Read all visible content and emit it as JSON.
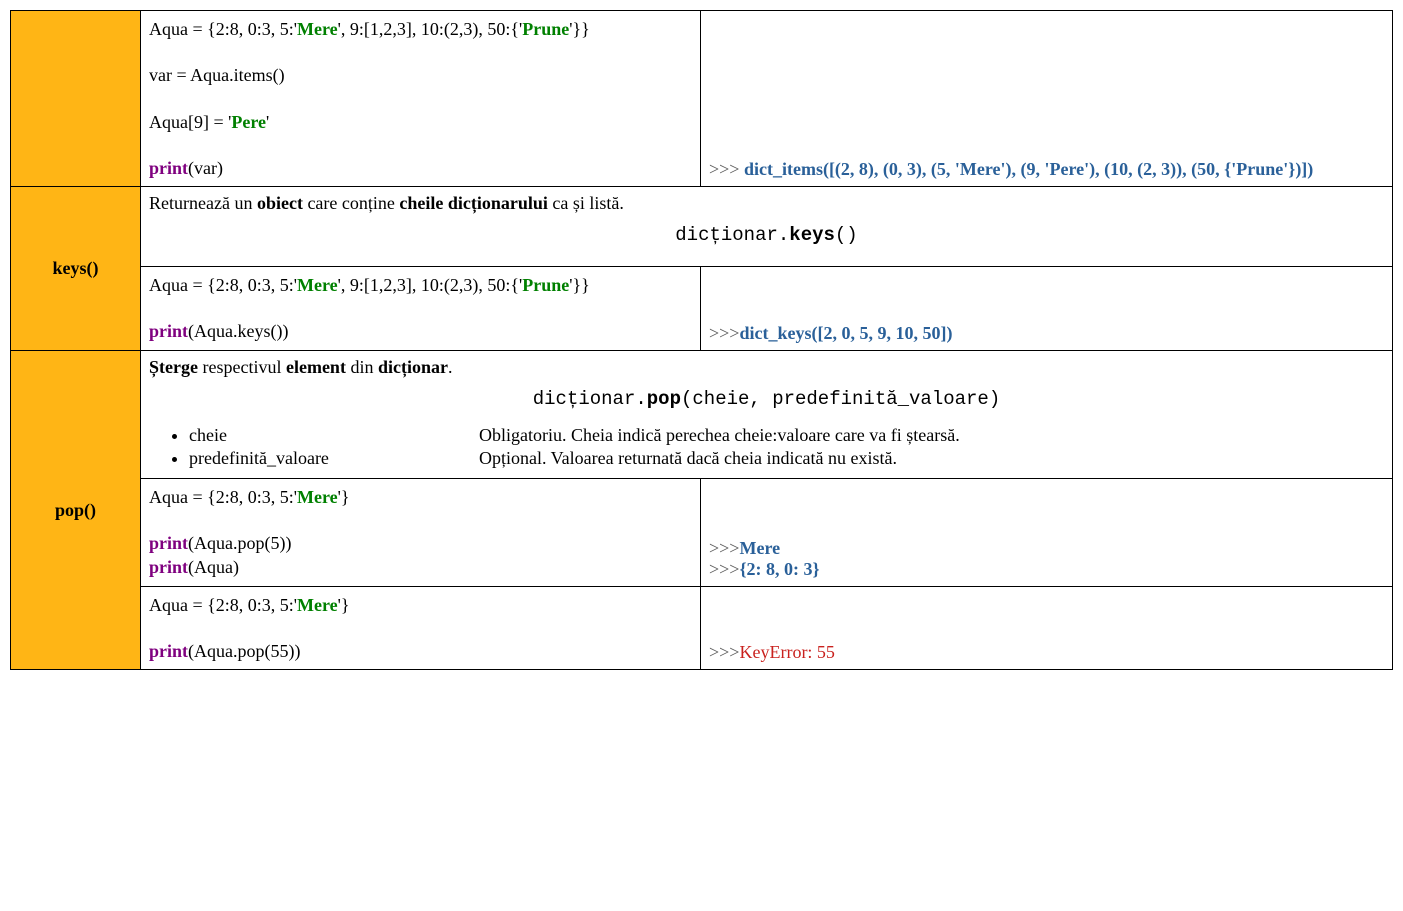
{
  "row_items": {
    "code": {
      "line1_pre": "Aqua = {2:8, 0:3, 5:'",
      "line1_s1": "Mere",
      "line1_mid": "', 9:[1,2,3], 10:(2,3), 50:{'",
      "line1_s2": "Prune",
      "line1_post": "'}}",
      "line2": "var = Aqua.items()",
      "line3_pre": "Aqua[9] = '",
      "line3_s": "Pere",
      "line3_post": "'",
      "line4_kw": "print",
      "line4_arg": "(var)"
    },
    "output": {
      "prompt": ">>> ",
      "text": "dict_items([(2, 8), (0, 3), (5, 'Mere'), (9, 'Pere'), (10, (2, 3)), (50, {'Prune'})])"
    }
  },
  "row_keys": {
    "name": "keys()",
    "desc": {
      "p1a": "Returnează un ",
      "p1b": "obiect",
      "p1c": " care conține ",
      "p1d": "cheile dicționarului",
      "p1e": " ca și listă."
    },
    "syntax": {
      "obj": "dicționar.",
      "method": "keys",
      "args": "()"
    },
    "code": {
      "line1_pre": "Aqua = {2:8, 0:3, 5:'",
      "line1_s1": "Mere",
      "line1_mid": "', 9:[1,2,3], 10:(2,3), 50:{'",
      "line1_s2": "Prune",
      "line1_post": "'}}",
      "line2_kw": "print",
      "line2_arg": "(Aqua.keys())"
    },
    "output": {
      "prompt": ">>>",
      "text": "dict_keys([2, 0, 5, 9, 10, 50])"
    }
  },
  "row_pop": {
    "name": "pop()",
    "desc": {
      "p1a": "Șterge",
      "p1b": " respectivul ",
      "p1c": "element",
      "p1d": " din ",
      "p1e": "dicționar",
      "p1f": "."
    },
    "syntax": {
      "obj": "dicționar.",
      "method": "pop",
      "args": "(cheie, predefinită_valoare)"
    },
    "params": [
      {
        "name": "cheie",
        "desc": "Obligatoriu. Cheia indică perechea cheie:valoare care va fi ștearsă."
      },
      {
        "name": "predefinită_valoare",
        "desc": "Opțional. Valoarea returnată dacă cheia indicată nu există."
      }
    ],
    "ex1": {
      "code": {
        "line1_pre": "Aqua = {2:8, 0:3, 5:'",
        "line1_s1": "Mere",
        "line1_post": "'}",
        "line2_kw": "print",
        "line2_arg": "(Aqua.pop(5))",
        "line3_kw": "print",
        "line3_arg": "(Aqua)"
      },
      "output": {
        "prompt": ">>>",
        "text1": "Mere",
        "text2": "{2: 8, 0: 3}"
      }
    },
    "ex2": {
      "code": {
        "line1_pre": "Aqua = {2:8, 0:3, 5:'",
        "line1_s1": "Mere",
        "line1_post": "'}",
        "line2_kw": "print",
        "line2_arg": "(Aqua.pop(55))"
      },
      "output": {
        "prompt": ">>>",
        "text": "KeyError: 55"
      }
    }
  }
}
